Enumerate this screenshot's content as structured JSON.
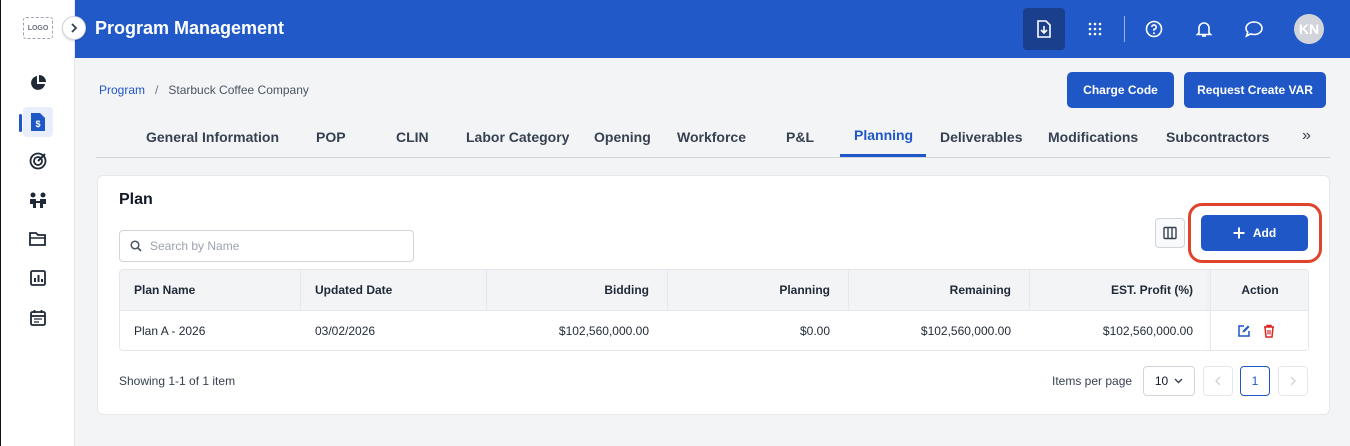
{
  "logo": "LOGO",
  "header": {
    "title": "Program Management",
    "avatar_initials": "KN"
  },
  "breadcrumb": {
    "root": "Program",
    "separator": "/",
    "current": "Starbuck Coffee Company"
  },
  "actions": {
    "charge_code": "Charge Code",
    "request_var": "Request Create VAR"
  },
  "tabs": [
    "General Information",
    "POP",
    "CLIN",
    "Labor Category",
    "Opening",
    "Workforce",
    "P&L",
    "Planning",
    "Deliverables",
    "Modifications",
    "Subcontractors"
  ],
  "active_tab": "Planning",
  "tabs_more": "»",
  "plan": {
    "title": "Plan",
    "search_placeholder": "Search by Name",
    "add_label": "Add",
    "columns": [
      "Plan Name",
      "Updated Date",
      "Bidding",
      "Planning",
      "Remaining",
      "EST. Profit (%)",
      "Action"
    ],
    "rows": [
      {
        "name": "Plan A - 2026",
        "updated": "03/02/2026",
        "bidding": "$102,560,000.00",
        "planning": "$0.00",
        "remaining": "$102,560,000.00",
        "profit": "$102,560,000.00"
      }
    ],
    "showing": "Showing 1-1 of 1 item",
    "items_per_page_label": "Items per page",
    "items_per_page": "10",
    "current_page": "1"
  },
  "colors": {
    "primary": "#2159c9",
    "highlight_ring": "#e0432b",
    "delete": "#dc2626"
  }
}
